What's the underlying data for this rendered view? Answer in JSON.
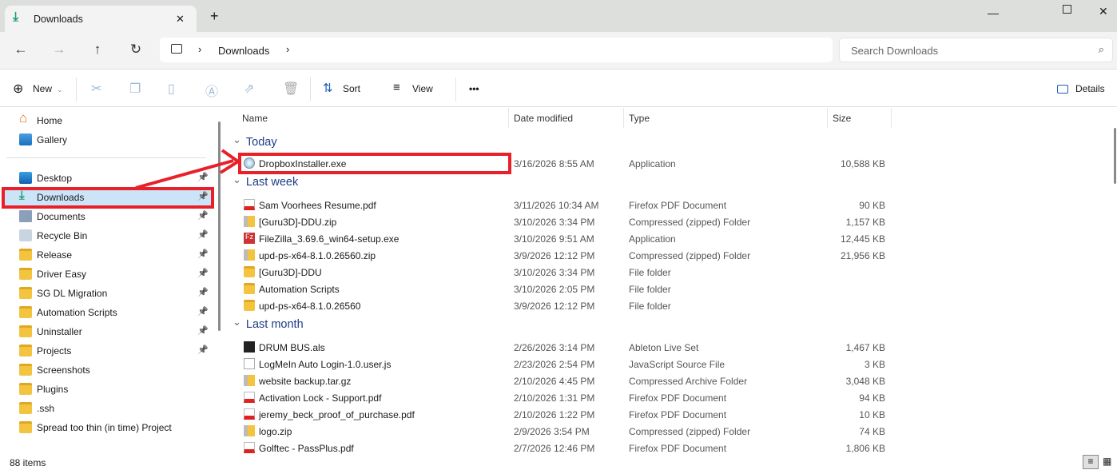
{
  "tab": {
    "title": "Downloads",
    "close": "✕",
    "new": "+"
  },
  "nav": {
    "back": "←",
    "forward": "→",
    "up": "↑",
    "refresh": "↻",
    "crumb": "Downloads",
    "search_placeholder": "Search Downloads"
  },
  "toolbar": {
    "new": "New",
    "sort": "Sort",
    "view": "View",
    "more": "•••",
    "details": "Details"
  },
  "sidebar": {
    "top": [
      {
        "label": "Home"
      },
      {
        "label": "Gallery"
      }
    ],
    "pinned": [
      {
        "label": "Desktop",
        "pin": true,
        "icon": "desktop"
      },
      {
        "label": "Downloads",
        "pin": true,
        "icon": "download"
      },
      {
        "label": "Documents",
        "pin": true,
        "icon": "doc"
      },
      {
        "label": "Recycle Bin",
        "pin": true,
        "icon": "bin"
      },
      {
        "label": "Release",
        "pin": true
      },
      {
        "label": "Driver Easy",
        "pin": true
      },
      {
        "label": "SG DL Migration",
        "pin": true
      },
      {
        "label": "Automation Scripts",
        "pin": true
      },
      {
        "label": "Uninstaller",
        "pin": true
      },
      {
        "label": "Projects",
        "pin": true
      },
      {
        "label": "Screenshots"
      },
      {
        "label": "Plugins"
      },
      {
        "label": ".ssh"
      },
      {
        "label": "Spread too thin (in time) Project"
      }
    ]
  },
  "columns": {
    "name": "Name",
    "date": "Date modified",
    "type": "Type",
    "size": "Size"
  },
  "groups": [
    {
      "label": "Today",
      "files": [
        {
          "name": "DropboxInstaller.exe",
          "date": "3/16/2026 8:55 AM",
          "type": "Application",
          "size": "10,588 KB",
          "icon": "setup"
        }
      ]
    },
    {
      "label": "Last week",
      "files": [
        {
          "name": "Sam Voorhees Resume.pdf",
          "date": "3/11/2026 10:34 AM",
          "type": "Firefox PDF Document",
          "size": "90 KB",
          "icon": "pdf"
        },
        {
          "name": "[Guru3D]-DDU.zip",
          "date": "3/10/2026 3:34 PM",
          "type": "Compressed (zipped) Folder",
          "size": "1,157 KB",
          "icon": "zip"
        },
        {
          "name": "FileZilla_3.69.6_win64-setup.exe",
          "date": "3/10/2026 9:51 AM",
          "type": "Application",
          "size": "12,445 KB",
          "icon": "exe"
        },
        {
          "name": "upd-ps-x64-8.1.0.26560.zip",
          "date": "3/9/2026 12:12 PM",
          "type": "Compressed (zipped) Folder",
          "size": "21,956 KB",
          "icon": "zip"
        },
        {
          "name": "[Guru3D]-DDU",
          "date": "3/10/2026 3:34 PM",
          "type": "File folder",
          "size": "",
          "icon": "folder"
        },
        {
          "name": "Automation Scripts",
          "date": "3/10/2026 2:05 PM",
          "type": "File folder",
          "size": "",
          "icon": "folder"
        },
        {
          "name": "upd-ps-x64-8.1.0.26560",
          "date": "3/9/2026 12:12 PM",
          "type": "File folder",
          "size": "",
          "icon": "folder"
        }
      ]
    },
    {
      "label": "Last month",
      "files": [
        {
          "name": "DRUM BUS.als",
          "date": "2/26/2026 3:14 PM",
          "type": "Ableton Live Set",
          "size": "1,467 KB",
          "icon": "als"
        },
        {
          "name": "LogMeIn Auto Login-1.0.user.js",
          "date": "2/23/2026 2:54 PM",
          "type": "JavaScript Source File",
          "size": "3 KB",
          "icon": "js"
        },
        {
          "name": "website backup.tar.gz",
          "date": "2/10/2026 4:45 PM",
          "type": "Compressed Archive Folder",
          "size": "3,048 KB",
          "icon": "zip"
        },
        {
          "name": "Activation Lock - Support.pdf",
          "date": "2/10/2026 1:31 PM",
          "type": "Firefox PDF Document",
          "size": "94 KB",
          "icon": "pdf"
        },
        {
          "name": "jeremy_beck_proof_of_purchase.pdf",
          "date": "2/10/2026 1:22 PM",
          "type": "Firefox PDF Document",
          "size": "10 KB",
          "icon": "pdf"
        },
        {
          "name": "logo.zip",
          "date": "2/9/2026 3:54 PM",
          "type": "Compressed (zipped) Folder",
          "size": "74 KB",
          "icon": "zip"
        },
        {
          "name": "Golftec - PassPlus.pdf",
          "date": "2/7/2026 12:46 PM",
          "type": "Firefox PDF Document",
          "size": "1,806 KB",
          "icon": "pdf"
        }
      ]
    }
  ],
  "status": {
    "count": "88 items"
  },
  "colors": {
    "accent": "#0067c0",
    "annotation": "#e8202a",
    "selected": "#cce4f7"
  }
}
